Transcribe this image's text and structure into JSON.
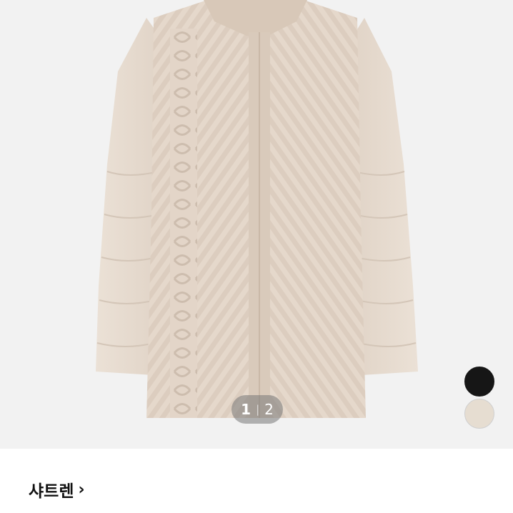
{
  "gallery": {
    "current_page": "1",
    "separator": "|",
    "total_pages": "2",
    "image_description_icon": "coat-photo"
  },
  "color_options": [
    {
      "name": "black",
      "color": "#161616"
    },
    {
      "name": "beige",
      "color": "#e6ddd1"
    }
  ],
  "product": {
    "brand": "샤트렌",
    "chevron": "›"
  }
}
